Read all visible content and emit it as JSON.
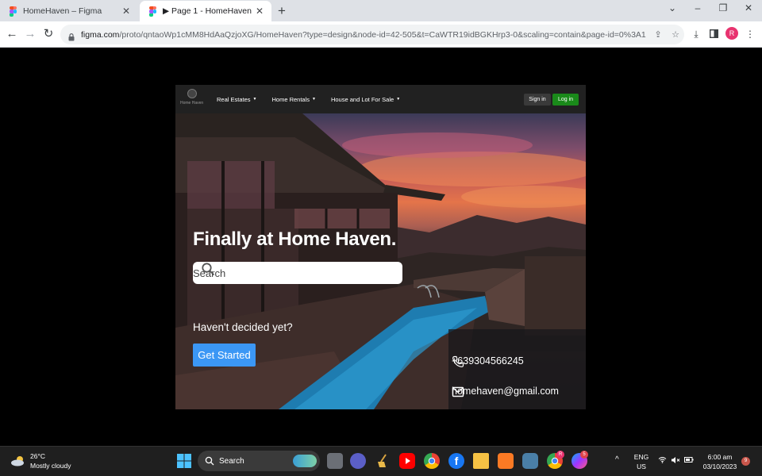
{
  "browser": {
    "tabs": [
      {
        "title": "HomeHaven – Figma",
        "active": false
      },
      {
        "title": "▶ Page 1 - HomeHaven",
        "active": true
      }
    ],
    "new_tab_label": "+",
    "window_controls": {
      "dropdown": "⌄",
      "minimize": "–",
      "restore": "❐",
      "close": "✕"
    },
    "url_host": "figma.com",
    "url_path": "/proto/qntaoWp1cMM8HdAaQzjoXG/HomeHaven?type=design&node-id=42-505&t=CaWTR19idBGKHrp3-0&scaling=contain&page-id=0%3A1",
    "profile_initial": "R"
  },
  "site": {
    "logo_text": "Home Haven",
    "nav": {
      "items": [
        "Real Estates",
        "Home Rentals",
        "House and Lot For Sale"
      ],
      "signin_label": "Sign in",
      "login_label": "Log in"
    },
    "hero": {
      "title": "Finally at Home Haven.",
      "search_placeholder": "Search",
      "undecided_text": "Haven't decided yet?",
      "cta_label": "Get Started"
    },
    "contact": {
      "phone": "+639304566245",
      "email": "homehaven@gmail.com"
    }
  },
  "taskbar": {
    "weather_temp": "26°C",
    "weather_desc": "Mostly cloudy",
    "search_label": "Search",
    "lang_top": "ENG",
    "lang_bottom": "US",
    "time": "6:00 am",
    "date": "03/10/2023",
    "notification_count": "9",
    "chrome_badge": "R",
    "messenger_badge": "5"
  },
  "colors": {
    "login_green": "#1a8a1a",
    "cta_blue": "#3b97f5",
    "nav_dark": "#212121"
  }
}
